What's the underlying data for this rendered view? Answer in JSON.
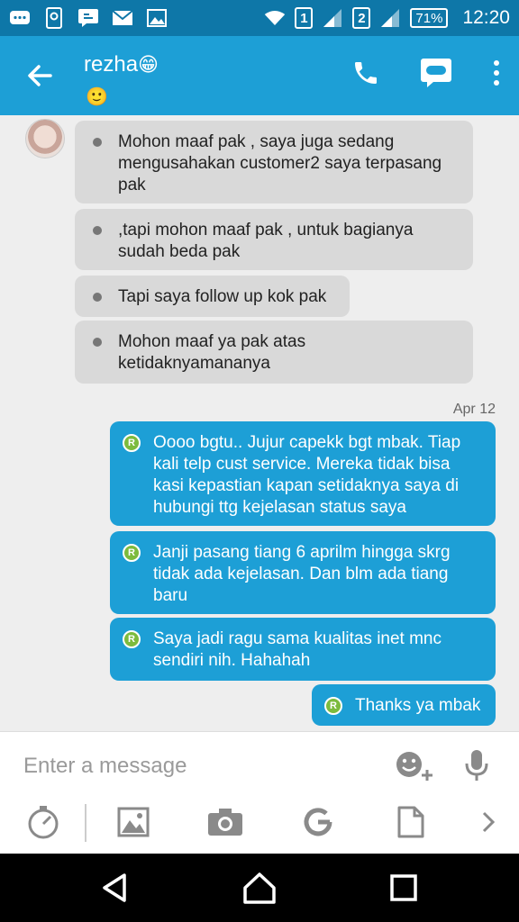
{
  "status_bar": {
    "sim1": "1",
    "sim2": "2",
    "battery": "71%",
    "time": "12:20"
  },
  "header": {
    "contact_name": "rezha",
    "name_emoji": "😁",
    "status_emoji": "🙂",
    "icons": [
      "back-arrow-icon",
      "phone-icon",
      "video-chat-icon",
      "more-vert-icon"
    ]
  },
  "messages_in": [
    {
      "lines": [
        "Mohon maaf pak , saya juga sedang",
        "mengusahakan customer2 saya terpasang",
        "pak"
      ]
    },
    {
      "lines": [
        ",tapi mohon maaf pak , untuk bagianya",
        "sudah beda pak"
      ]
    },
    {
      "lines": [
        "Tapi saya follow up kok pak"
      ]
    },
    {
      "lines": [
        "Mohon maaf ya pak atas",
        "ketidaknyamananya"
      ]
    }
  ],
  "date_separator": "Apr 12",
  "out_badge": "R",
  "messages_out": [
    {
      "lines": [
        "Oooo bgtu.. Jujur capekk bgt mbak. Tiap",
        "kali telp cust service. Mereka tidak bisa",
        "kasi kepastian kapan setidaknya saya di",
        "hubungi ttg kejelasan status saya"
      ]
    },
    {
      "lines": [
        "Janji pasang tiang 6 aprilm hingga skrg",
        "tidak ada kejelasan. Dan blm ada tiang",
        "baru"
      ]
    },
    {
      "lines": [
        "Saya jadi ragu sama kualitas inet mnc",
        "sendiri nih. Hahahah"
      ]
    },
    {
      "lines": [
        "Thanks ya mbak"
      ]
    }
  ],
  "composer": {
    "placeholder": "Enter a message",
    "value": ""
  },
  "colors": {
    "status_bar": "#0e77a8",
    "app_bar": "#1d9fd6",
    "incoming_bubble": "#d9d9d9",
    "outgoing_bubble": "#1d9fd6",
    "badge": "#7cbb3d"
  }
}
